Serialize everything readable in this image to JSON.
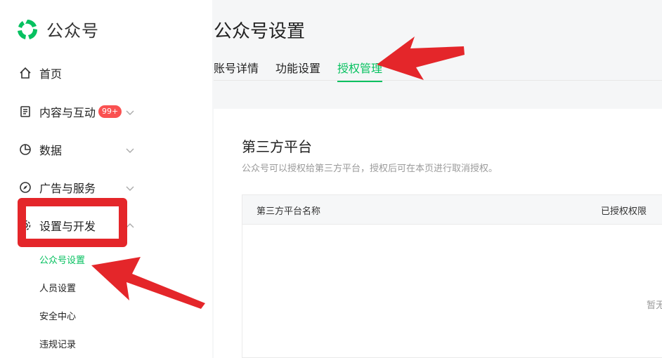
{
  "brand": {
    "name": "公众号",
    "logo_icon": "wechat-official-account-logo",
    "color": "#07c160"
  },
  "sidebar": {
    "items": [
      {
        "label": "首页",
        "icon": "home-icon"
      },
      {
        "label": "内容与互动",
        "icon": "document-icon",
        "badge": "99+"
      },
      {
        "label": "数据",
        "icon": "chart-pie-icon"
      },
      {
        "label": "广告与服务",
        "icon": "compass-icon"
      },
      {
        "label": "设置与开发",
        "icon": "gear-icon"
      }
    ],
    "sub_items": [
      {
        "label": "公众号设置",
        "active": true
      },
      {
        "label": "人员设置"
      },
      {
        "label": "安全中心"
      },
      {
        "label": "违规记录"
      }
    ]
  },
  "main": {
    "title": "公众号设置",
    "tabs": [
      {
        "label": "账号详情"
      },
      {
        "label": "功能设置"
      },
      {
        "label": "授权管理",
        "active": true
      }
    ],
    "section": {
      "title": "第三方平台",
      "description": "公众号可以授权给第三方平台，授权后可在本页进行取消授权。",
      "table": {
        "columns": [
          "第三方平台名称",
          "已授权权限"
        ],
        "empty_text": "暂无"
      }
    }
  },
  "colors": {
    "accent": "#07c160",
    "badge": "#fa5151",
    "annotation": "#e4262a"
  }
}
